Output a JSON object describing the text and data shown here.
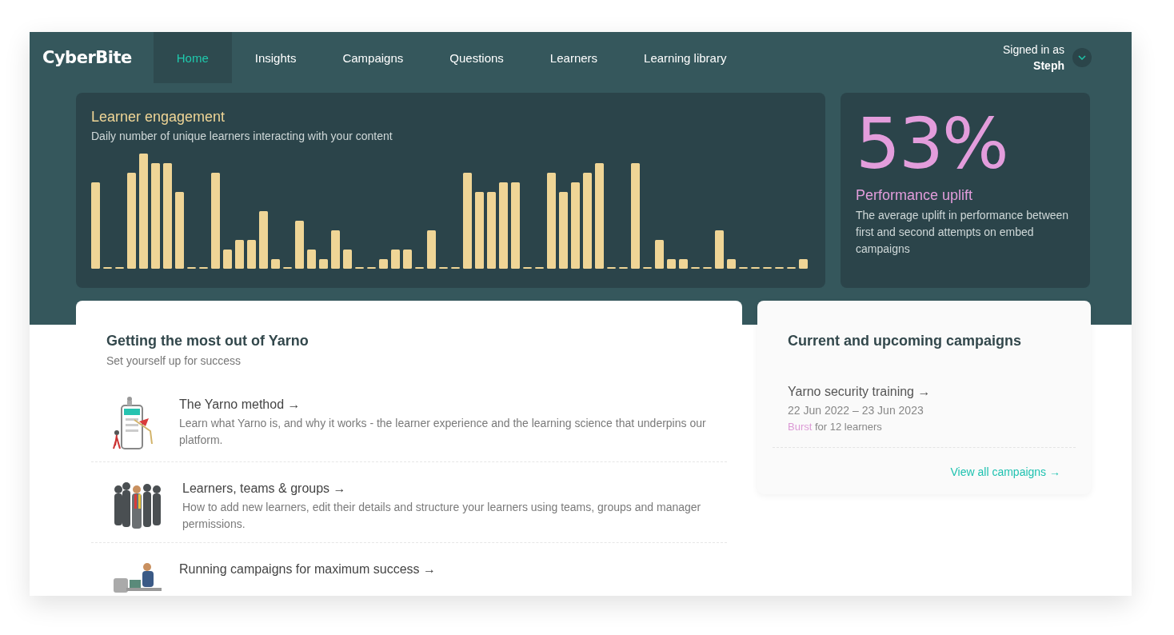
{
  "brand": {
    "logo": "CyberBite"
  },
  "nav": [
    {
      "label": "Home",
      "selected": true
    },
    {
      "label": "Insights",
      "selected": false
    },
    {
      "label": "Campaigns",
      "selected": false
    },
    {
      "label": "Questions",
      "selected": false
    },
    {
      "label": "Learners",
      "selected": false
    },
    {
      "label": "Learning library",
      "selected": false
    }
  ],
  "account": {
    "caption": "Signed in as",
    "name": "Steph"
  },
  "engagement": {
    "title": "Learner engagement",
    "subtitle": "Daily number of unique learners interacting with your content"
  },
  "uplift": {
    "value": "53%",
    "title": "Performance uplift",
    "description": "The average uplift in performance between first and second attempts on embed campaigns"
  },
  "guide": {
    "title": "Getting the most out of Yarno",
    "subtitle": "Set yourself up for success",
    "items": [
      {
        "kind": "phone",
        "title": "The Yarno method →",
        "description": "Learn what Yarno is, and why it works - the learner experience and the learning science that underpins our platform."
      },
      {
        "kind": "crowd",
        "title": "Learners, teams & groups →",
        "description": "How to add new learners, edit their details and structure your learners using teams, groups and manager permissions."
      },
      {
        "kind": "desk",
        "title": "Running campaigns for maximum success →"
      }
    ]
  },
  "campaigns": {
    "title": "Current and upcoming campaigns",
    "items": [
      {
        "name": "Yarno security training →",
        "dates": "22 Jun 2022 – 23 Jun 2023",
        "type": "Burst",
        "audience": "for 12 learners"
      }
    ],
    "link": "View all campaigns →"
  }
}
